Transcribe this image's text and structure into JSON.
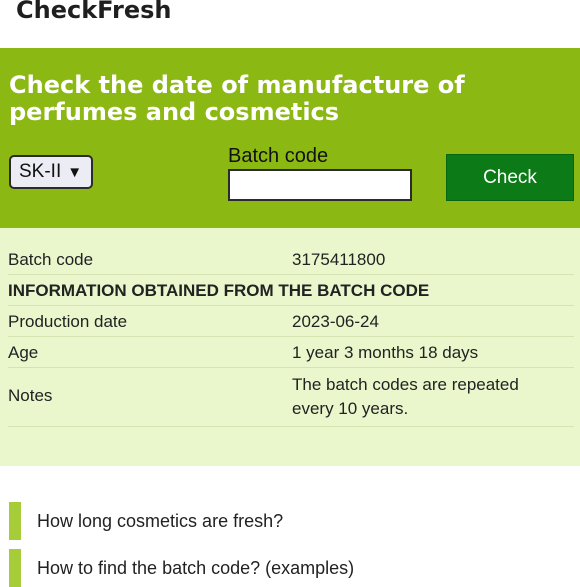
{
  "app": {
    "title": "CheckFresh"
  },
  "hero": {
    "title": "Check the date of manufacture of perfumes and cosmetics",
    "brand_select": {
      "value": "SK-II",
      "caret": "▼"
    },
    "batch_label": "Batch code",
    "batch_input": {
      "value": "",
      "placeholder": ""
    },
    "check_label": "Check"
  },
  "results": {
    "batch_code": {
      "label": "Batch code",
      "value": "3175411800"
    },
    "section_header": "INFORMATION OBTAINED FROM THE BATCH CODE",
    "production_date": {
      "label": "Production date",
      "value": "2023-06-24"
    },
    "age": {
      "label": "Age",
      "value": "1 year 3 months 18 days"
    },
    "notes": {
      "label": "Notes",
      "value": "The batch codes are repeated every 10 years."
    }
  },
  "links": [
    {
      "label": "How long cosmetics are fresh?"
    },
    {
      "label": "How to find the batch code? (examples)"
    }
  ],
  "colors": {
    "hero_bg": "#8cb814",
    "check_button_bg": "#0b7a17",
    "results_bg": "#eaf7cd",
    "link_accent": "#a6cc3a"
  }
}
